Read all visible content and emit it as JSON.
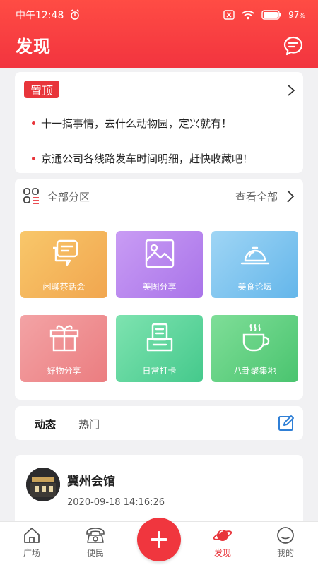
{
  "status_bar": {
    "time": "中午12:48",
    "battery": "97"
  },
  "header": {
    "title": "发现"
  },
  "pinned": {
    "badge": "置顶",
    "items": [
      "十一搞事情，去什么动物园，定兴就有！",
      "京通公司各线路发车时间明细，赶快收藏吧！"
    ]
  },
  "categories": {
    "title": "全部分区",
    "view_all": "查看全部",
    "tiles": [
      {
        "label": "闲聊茶话会",
        "icon": "chat-icon"
      },
      {
        "label": "美图分享",
        "icon": "image-icon"
      },
      {
        "label": "美食论坛",
        "icon": "food-cloche-icon"
      },
      {
        "label": "好物分享",
        "icon": "gift-icon"
      },
      {
        "label": "日常打卡",
        "icon": "checkin-printer-icon"
      },
      {
        "label": "八卦聚集地",
        "icon": "coffee-cup-icon"
      }
    ]
  },
  "feed_tabs": [
    "动态",
    "热门"
  ],
  "post": {
    "author": "冀州会馆",
    "time": "2020-09-18 14:16:26"
  },
  "bottom_nav": [
    {
      "label": "广场",
      "icon": "home-icon"
    },
    {
      "label": "便民",
      "icon": "phone-icon"
    },
    {
      "label": "发现",
      "icon": "planet-icon",
      "active": true
    },
    {
      "label": "我的",
      "icon": "face-icon"
    }
  ],
  "colors": {
    "accent": "#e8353b",
    "header": "#f2343f",
    "background": "#f1f1f3"
  }
}
